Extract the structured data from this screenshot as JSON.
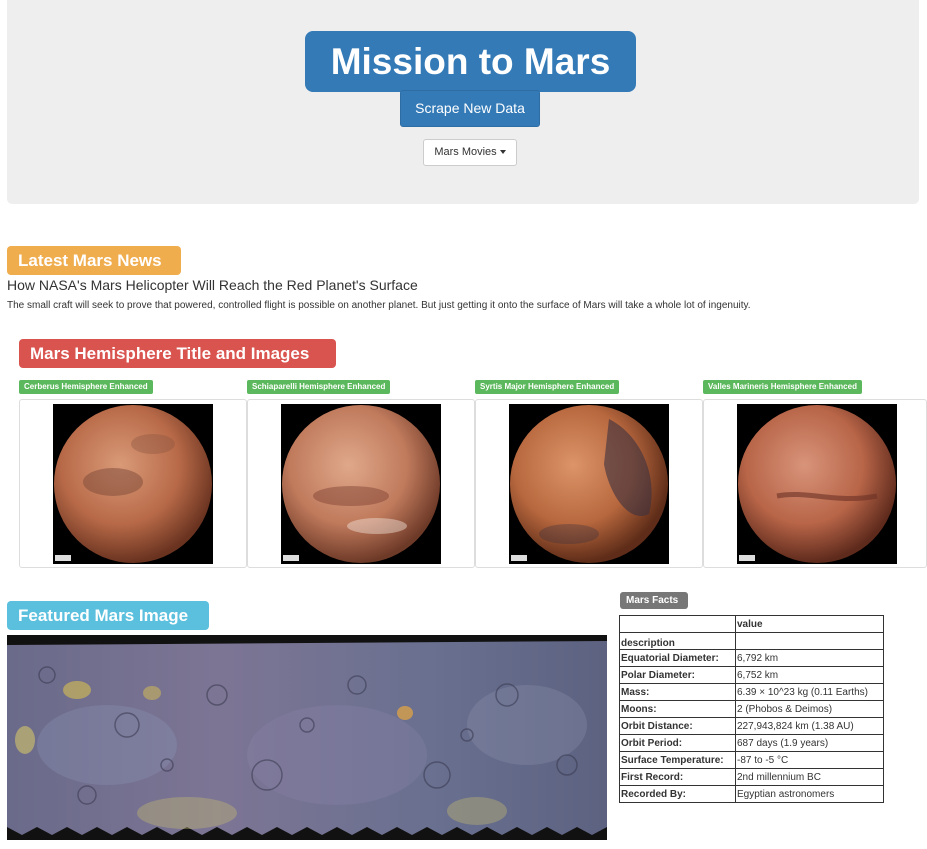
{
  "header": {
    "title": "Mission to Mars",
    "scrape_button": "Scrape New Data",
    "movies_dropdown": "Mars Movies"
  },
  "news": {
    "section_label": "Latest Mars News",
    "title": "How NASA's Mars Helicopter Will Reach the Red Planet's Surface",
    "paragraph": "The small craft will seek to prove that powered, controlled flight is possible on another planet. But just getting it onto the surface of Mars will take a whole lot of ingenuity."
  },
  "hemispheres": {
    "section_label": "Mars Hemisphere Title and Images",
    "items": [
      {
        "title": "Cerberus Hemisphere Enhanced",
        "tone": "#b86a48"
      },
      {
        "title": "Schiaparelli Hemisphere Enhanced",
        "tone": "#c07a5c"
      },
      {
        "title": "Syrtis Major Hemisphere Enhanced",
        "tone": "#b8683e"
      },
      {
        "title": "Valles Marineris Hemisphere Enhanced",
        "tone": "#b86548"
      }
    ]
  },
  "featured": {
    "section_label": "Featured Mars Image"
  },
  "facts": {
    "section_label": "Mars Facts",
    "column_header": "value",
    "index_header": "description",
    "rows": [
      {
        "key": "Equatorial Diameter:",
        "value": "6,792 km"
      },
      {
        "key": "Polar Diameter:",
        "value": "6,752 km"
      },
      {
        "key": "Mass:",
        "value": "6.39 × 10^23 kg (0.11 Earths)"
      },
      {
        "key": "Moons:",
        "value": "2 (Phobos & Deimos)"
      },
      {
        "key": "Orbit Distance:",
        "value": "227,943,824 km (1.38 AU)"
      },
      {
        "key": "Orbit Period:",
        "value": "687 days (1.9 years)"
      },
      {
        "key": "Surface Temperature:",
        "value": "-87 to -5 °C"
      },
      {
        "key": "First Record:",
        "value": "2nd millennium BC"
      },
      {
        "key": "Recorded By:",
        "value": "Egyptian astronomers"
      }
    ]
  },
  "colors": {
    "primary": "#337ab7",
    "warning": "#f0ad4e",
    "danger": "#d9534f",
    "info": "#5bc0de",
    "success": "#5cb85c",
    "default_label": "#777777",
    "jumbotron": "#eeeeee"
  }
}
